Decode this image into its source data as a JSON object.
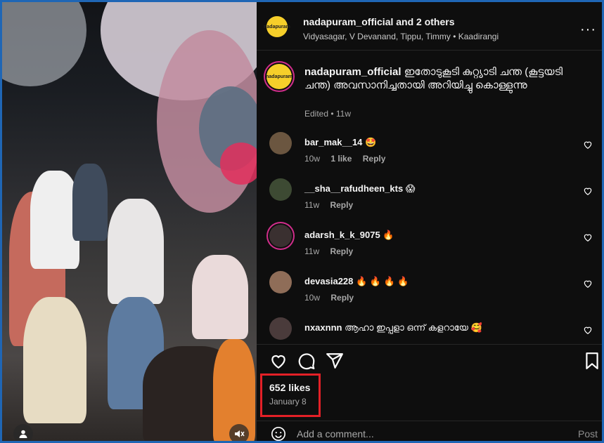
{
  "header": {
    "username": "nadapuram_official",
    "collab_suffix": "and 2 others",
    "subtitle": "Vidyasagar, V Devanand, Tippu, Timmy • Kaadirangi",
    "avatar_text": "nadapuram",
    "more_icon": "more-horizontal-icon"
  },
  "caption": {
    "username": "nadapuram_official",
    "text": "ഇതോടുകൂടി കുറ്റ്യാടി ചന്ത (കൂട്ടയടി ചന്ത) അവസാനിച്ചതായി അറിയിച്ചു കൊള്ളുന്നു",
    "meta": "Edited • 11w"
  },
  "comments": [
    {
      "username": "bar_mak__14",
      "text": "🤩",
      "time": "10w",
      "likes": "1 like",
      "reply": "Reply",
      "avatar_color": "#6b5640"
    },
    {
      "username": "__sha__rafudheen_kts",
      "text": "😱",
      "time": "11w",
      "likes": "",
      "reply": "Reply",
      "avatar_color": "#3d4a33"
    },
    {
      "username": "adarsh_k_k_9075",
      "text": "🔥",
      "time": "11w",
      "likes": "",
      "reply": "Reply",
      "avatar_color": "#3a3030"
    },
    {
      "username": "devasia228",
      "text": "🔥 🔥 🔥 🔥",
      "time": "10w",
      "likes": "",
      "reply": "Reply",
      "avatar_color": "#8f6d58"
    },
    {
      "username": "nxaxnnn",
      "text": "ആഹാ ഇപ്പളാ ഒന്ന് കളറായേ 🥰",
      "time": "",
      "likes": "",
      "reply": "",
      "avatar_color": "#4a3b3b"
    }
  ],
  "actions": {
    "like_icon": "heart-icon",
    "comment_icon": "comment-icon",
    "share_icon": "share-icon",
    "save_icon": "bookmark-icon"
  },
  "stats": {
    "likes": "652 likes",
    "date": "January 8"
  },
  "composer": {
    "placeholder": "Add a comment...",
    "post_label": "Post",
    "emoji_icon": "emoji-icon"
  },
  "video": {
    "mute_icon": "muted-speaker-icon",
    "user_icon": "user-tag-icon"
  },
  "colors": {
    "highlight": "#e32027",
    "border": "#1f66b5",
    "brand_avatar": "#f6cf2a",
    "story_ring": "#d12e8b"
  }
}
